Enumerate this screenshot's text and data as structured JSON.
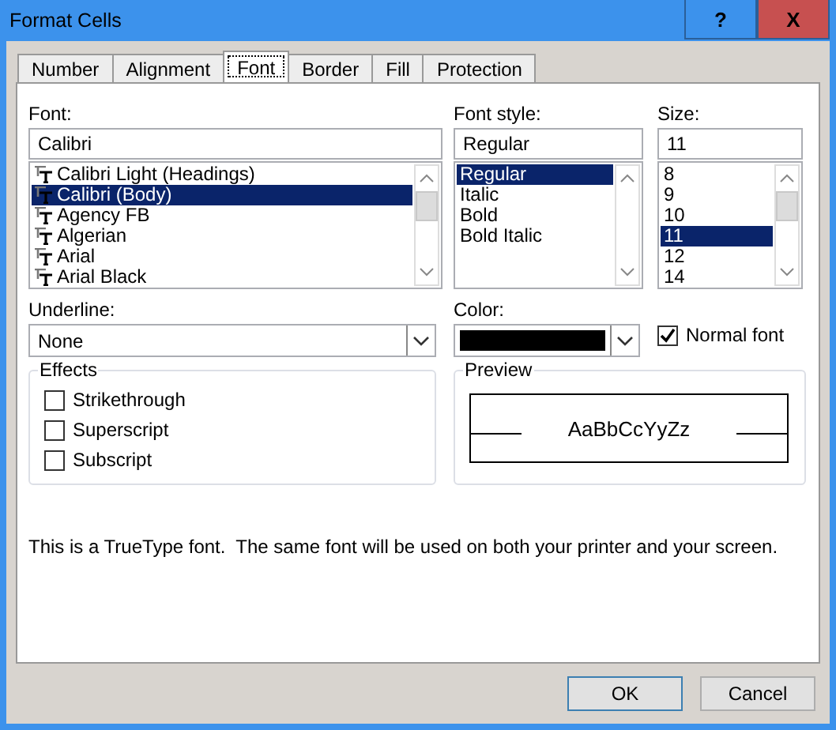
{
  "window": {
    "title": "Format Cells",
    "help_button": "?",
    "close_button": "X"
  },
  "tabs": [
    {
      "label": "Number",
      "selected": false
    },
    {
      "label": "Alignment",
      "selected": false
    },
    {
      "label": "Font",
      "selected": true
    },
    {
      "label": "Border",
      "selected": false
    },
    {
      "label": "Fill",
      "selected": false
    },
    {
      "label": "Protection",
      "selected": false
    }
  ],
  "font": {
    "label": "Font:",
    "value": "Calibri",
    "items": [
      {
        "label": "Calibri Light (Headings)",
        "selected": false
      },
      {
        "label": "Calibri (Body)",
        "selected": true
      },
      {
        "label": "Agency FB",
        "selected": false
      },
      {
        "label": "Algerian",
        "selected": false
      },
      {
        "label": "Arial",
        "selected": false
      },
      {
        "label": "Arial Black",
        "selected": false
      }
    ]
  },
  "font_style": {
    "label": "Font style:",
    "value": "Regular",
    "items": [
      {
        "label": "Regular",
        "selected": true
      },
      {
        "label": "Italic",
        "selected": false
      },
      {
        "label": "Bold",
        "selected": false
      },
      {
        "label": "Bold Italic",
        "selected": false
      }
    ]
  },
  "size": {
    "label": "Size:",
    "value": "11",
    "items": [
      {
        "label": "8",
        "selected": false
      },
      {
        "label": "9",
        "selected": false
      },
      {
        "label": "10",
        "selected": false
      },
      {
        "label": "11",
        "selected": true
      },
      {
        "label": "12",
        "selected": false
      },
      {
        "label": "14",
        "selected": false
      }
    ]
  },
  "underline": {
    "label": "Underline:",
    "value": "None"
  },
  "color": {
    "label": "Color:"
  },
  "normal_font": {
    "label": "Normal font",
    "checked": true
  },
  "effects": {
    "title": "Effects",
    "options": [
      {
        "label": "Strikethrough",
        "checked": false
      },
      {
        "label": "Superscript",
        "checked": false
      },
      {
        "label": "Subscript",
        "checked": false
      }
    ]
  },
  "preview": {
    "title": "Preview",
    "sample": "AaBbCcYyZz"
  },
  "description": "This is a TrueType font.  The same font will be used on both your printer and your screen.",
  "buttons": [
    {
      "label": "OK",
      "default": true
    },
    {
      "label": "Cancel",
      "default": false
    }
  ]
}
